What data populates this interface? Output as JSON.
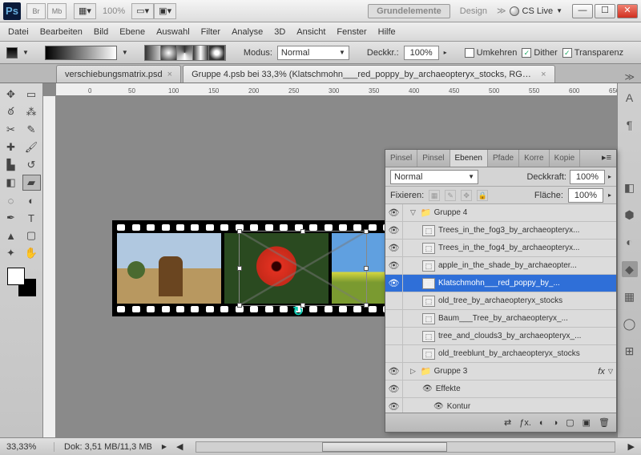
{
  "titlebar": {
    "ps": "Ps",
    "br": "Br",
    "mb": "Mb",
    "zoom": "100%",
    "essentials": "Grundelemente",
    "design": "Design",
    "cslive": "CS Live"
  },
  "menu": [
    "Datei",
    "Bearbeiten",
    "Bild",
    "Ebene",
    "Auswahl",
    "Filter",
    "Analyse",
    "3D",
    "Ansicht",
    "Fenster",
    "Hilfe"
  ],
  "options": {
    "modus_label": "Modus:",
    "modus_value": "Normal",
    "opacity_label": "Deckkr.:",
    "opacity_value": "100%",
    "reverse": "Umkehren",
    "dither": "Dither",
    "transparency": "Transparenz"
  },
  "tabs": [
    {
      "label": "verschiebungsmatrix.psd",
      "active": false
    },
    {
      "label": "Gruppe 4.psb bei 33,3% (Klatschmohn___red_poppy_by_archaeopteryx_stocks, RGB/8) *",
      "active": true
    }
  ],
  "ruler_marks": [
    "50",
    "0",
    "50",
    "100",
    "150",
    "200",
    "250",
    "300",
    "350",
    "400",
    "450",
    "500",
    "550",
    "600",
    "650"
  ],
  "panel": {
    "tabs": [
      "Pinsel",
      "Pinsel",
      "Ebenen",
      "Pfade",
      "Korre",
      "Kopie"
    ],
    "active_tab": "Ebenen",
    "blend": "Normal",
    "opacity_label": "Deckkraft:",
    "opacity_value": "100%",
    "lock_label": "Fixieren:",
    "fill_label": "Fläche:",
    "fill_value": "100%",
    "layers": [
      {
        "eye": true,
        "indent": 0,
        "type": "group",
        "name": "Gruppe 4",
        "open": true
      },
      {
        "eye": true,
        "indent": 1,
        "type": "so",
        "name": "Trees_in_the_fog3_by_archaeopteryx..."
      },
      {
        "eye": true,
        "indent": 1,
        "type": "so",
        "name": "Trees_in_the_fog4_by_archaeopteryx..."
      },
      {
        "eye": true,
        "indent": 1,
        "type": "so",
        "name": "apple_in_the_shade_by_archaeopter..."
      },
      {
        "eye": true,
        "indent": 1,
        "type": "so",
        "name": "Klatschmohn___red_poppy_by_...",
        "selected": true
      },
      {
        "eye": false,
        "indent": 1,
        "type": "so",
        "name": "old_tree_by_archaeopteryx_stocks"
      },
      {
        "eye": false,
        "indent": 1,
        "type": "so",
        "name": "Baum___Tree_by_archaeopteryx_..."
      },
      {
        "eye": false,
        "indent": 1,
        "type": "so",
        "name": "tree_and_clouds3_by_archaeopteryx_..."
      },
      {
        "eye": false,
        "indent": 1,
        "type": "so",
        "name": "old_treeblunt_by_archaeopteryx_stocks"
      },
      {
        "eye": true,
        "indent": 0,
        "type": "group",
        "name": "Gruppe 3",
        "fx": "fx"
      },
      {
        "eye": true,
        "indent": 1,
        "type": "fx",
        "name": "Effekte"
      },
      {
        "eye": true,
        "indent": 2,
        "type": "fx",
        "name": "Kontur"
      }
    ]
  },
  "status": {
    "zoom": "33,33%",
    "doc": "Dok: 3,51 MB/11,3 MB"
  }
}
